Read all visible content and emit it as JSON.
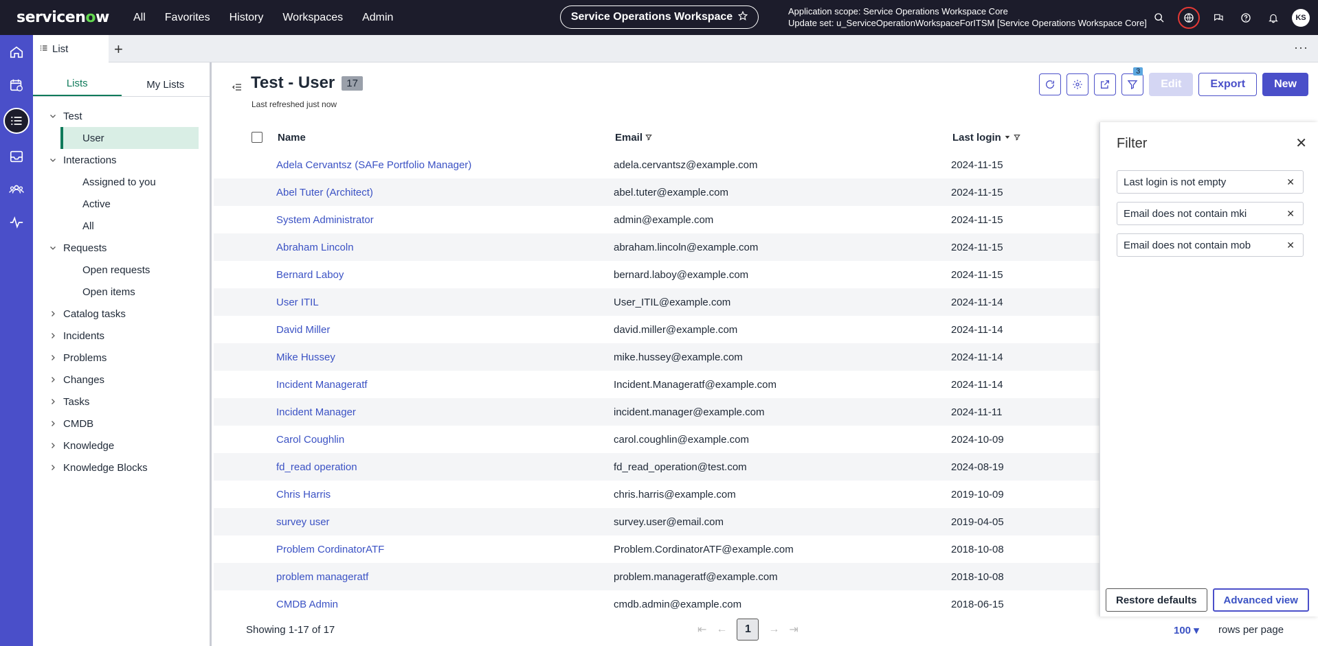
{
  "topbar": {
    "logo_prefix": "servicen",
    "logo_o": "o",
    "logo_suffix": "w",
    "nav": [
      "All",
      "Favorites",
      "History",
      "Workspaces",
      "Admin"
    ],
    "workspace_label": "Service Operations Workspace",
    "scope_line1": "Application scope: Service Operations Workspace Core",
    "scope_line2": "Update set: u_ServiceOperationWorkspaceForITSM [Service Operations Workspace Core]",
    "avatar_initials": "KS"
  },
  "tabs": {
    "current_tab": "List",
    "add_label": "+",
    "more_label": "···"
  },
  "lists_panel": {
    "tab_lists": "Lists",
    "tab_my_lists": "My Lists",
    "tree": [
      {
        "label": "Test",
        "expanded": true
      },
      {
        "label": "User",
        "child": true,
        "selected": true
      },
      {
        "label": "Interactions",
        "expanded": true
      },
      {
        "label": "Assigned to you",
        "child": true
      },
      {
        "label": "Active",
        "child": true
      },
      {
        "label": "All",
        "child": true
      },
      {
        "label": "Requests",
        "expanded": true
      },
      {
        "label": "Open requests",
        "child": true
      },
      {
        "label": "Open items",
        "child": true
      },
      {
        "label": "Catalog tasks",
        "expanded": false
      },
      {
        "label": "Incidents",
        "expanded": false
      },
      {
        "label": "Problems",
        "expanded": false
      },
      {
        "label": "Changes",
        "expanded": false
      },
      {
        "label": "Tasks",
        "expanded": false
      },
      {
        "label": "CMDB",
        "expanded": false
      },
      {
        "label": "Knowledge",
        "expanded": false
      },
      {
        "label": "Knowledge Blocks",
        "expanded": false
      }
    ]
  },
  "header": {
    "title": "Test - User",
    "count": "17",
    "subtitle": "Last refreshed just now",
    "filter_count": "3",
    "edit_label": "Edit",
    "export_label": "Export",
    "new_label": "New"
  },
  "table": {
    "col_name": "Name",
    "col_email": "Email",
    "col_login": "Last login",
    "rows": [
      {
        "name": "Adela Cervantsz (SAFe Portfolio Manager)",
        "email": "adela.cervantsz@example.com",
        "date": "2024-11-15"
      },
      {
        "name": "Abel Tuter (Architect)",
        "email": "abel.tuter@example.com",
        "date": "2024-11-15"
      },
      {
        "name": "System Administrator",
        "email": "admin@example.com",
        "date": "2024-11-15"
      },
      {
        "name": "Abraham Lincoln",
        "email": "abraham.lincoln@example.com",
        "date": "2024-11-15"
      },
      {
        "name": "Bernard Laboy",
        "email": "bernard.laboy@example.com",
        "date": "2024-11-15"
      },
      {
        "name": "User ITIL",
        "email": "User_ITIL@example.com",
        "date": "2024-11-14"
      },
      {
        "name": "David Miller",
        "email": "david.miller@example.com",
        "date": "2024-11-14"
      },
      {
        "name": "Mike  Hussey",
        "email": "mike.hussey@example.com",
        "date": "2024-11-14"
      },
      {
        "name": "Incident Manageratf",
        "email": "Incident.Manageratf@example.com",
        "date": "2024-11-14"
      },
      {
        "name": "Incident Manager",
        "email": "incident.manager@example.com",
        "date": "2024-11-11"
      },
      {
        "name": "Carol Coughlin",
        "email": "carol.coughlin@example.com",
        "date": "2024-10-09"
      },
      {
        "name": "fd_read operation",
        "email": "fd_read_operation@test.com",
        "date": "2024-08-19"
      },
      {
        "name": "Chris Harris",
        "email": "chris.harris@example.com",
        "date": "2019-10-09"
      },
      {
        "name": "survey user",
        "email": "survey.user@email.com",
        "date": "2019-04-05"
      },
      {
        "name": "Problem CordinatorATF",
        "email": "Problem.CordinatorATF@example.com",
        "date": "2018-10-08"
      },
      {
        "name": "problem manageratf",
        "email": "problem.manageratf@example.com",
        "date": "2018-10-08"
      },
      {
        "name": "CMDB Admin",
        "email": "cmdb.admin@example.com",
        "date": "2018-06-15"
      }
    ]
  },
  "footer": {
    "showing": "Showing 1-17 of 17",
    "page": "1",
    "rows_per_page_value": "100",
    "rows_per_page_label": "rows per page"
  },
  "filter_panel": {
    "title": "Filter",
    "chips": [
      "Last login is not empty",
      "Email does not contain mki",
      "Email does not contain mob"
    ],
    "restore_label": "Restore defaults",
    "advanced_label": "Advanced view"
  },
  "colors": {
    "topbar": "#1c1c2b",
    "rail": "#4a4fc9",
    "accent": "#4a4fc9",
    "link": "#3b52c4",
    "lists_green": "#0f7a5a"
  }
}
